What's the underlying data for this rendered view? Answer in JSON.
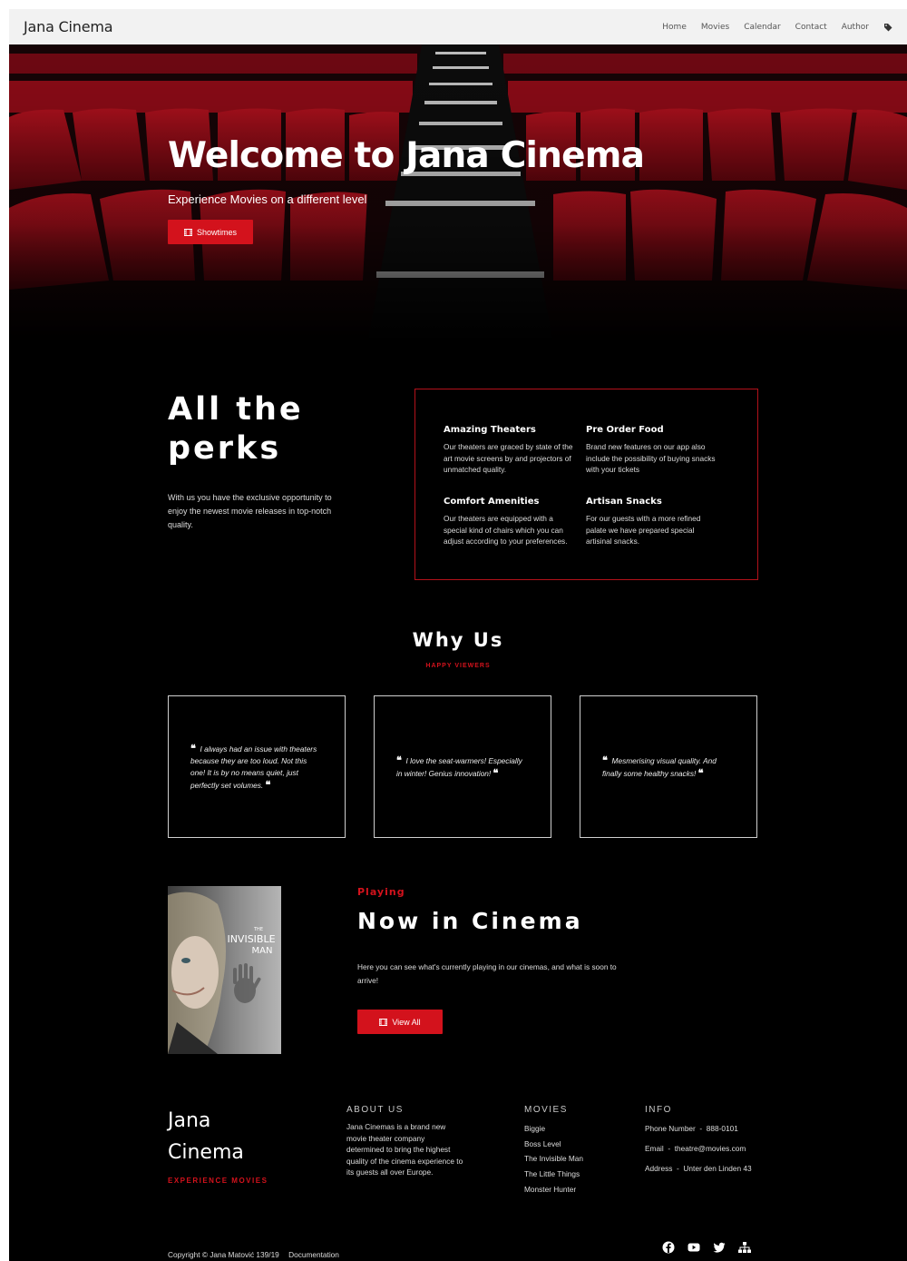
{
  "nav": {
    "brand": "Jana Cinema",
    "items": [
      "Home",
      "Movies",
      "Calendar",
      "Contact",
      "Author"
    ]
  },
  "hero": {
    "title": "Welcome to Jana Cinema",
    "subtitle": "Experience Movies on a different level",
    "button": "Showtimes"
  },
  "perks": {
    "title_line1": "All the",
    "title_line2": "perks",
    "description": "With us you have the exclusive opportunity to enjoy the newest movie releases in top-notch quality.",
    "items": [
      {
        "title": "Amazing Theaters",
        "text": "Our theaters are graced by state of the art movie screens by and projectors of unmatched quality."
      },
      {
        "title": "Pre Order Food",
        "text": "Brand new features on our app also include the possibility of buying snacks with your tickets"
      },
      {
        "title": "Comfort Amenities",
        "text": "Our theaters are equipped with a special kind of chairs which you can adjust according to your preferences."
      },
      {
        "title": "Artisan Snacks",
        "text": "For our guests with a more refined palate we have prepared special artisinal snacks."
      }
    ]
  },
  "why": {
    "title": "Why Us",
    "subtitle": "HAPPY VIEWERS",
    "quotes": [
      "I always had an issue with theaters because they are too loud. Not this one! It is by no means quiet, just perfectly set volumes.",
      "I love the seat-warmers! Especially in winter! Genius innovation!",
      "Mesmerising visual quality. And finally some healthy snacks!"
    ]
  },
  "now": {
    "label": "Playing",
    "title": "Now in Cinema",
    "description": "Here you can see what's currently playing in our cinemas, and what is soon to arrive!",
    "button": "View All",
    "poster": {
      "title_line1": "THE",
      "title_line2": "INVISIBLE",
      "title_line3": "MAN"
    }
  },
  "footer": {
    "brand_line1": "Jana",
    "brand_line2": "Cinema",
    "tagline": "EXPERIENCE MOVIES",
    "about_title": "ABOUT US",
    "about_text": "Jana Cinemas is a brand new movie theater company determined to bring the highest quality of the cinema experience to its guests all over Europe.",
    "movies_title": "MOVIES",
    "movies": [
      "Biggie",
      "Boss Level",
      "The Invisible Man",
      "The Little Things",
      "Monster Hunter"
    ],
    "info_title": "INFO",
    "info": [
      "Phone Number  -  888-0101",
      "Email  -  theatre@movies.com",
      "Address  -  Unter den Linden 43"
    ],
    "copyright": "Copyright © Jana Matović 139/19",
    "documentation": "Documentation"
  },
  "colors": {
    "accent": "#d3121c",
    "background": "#000000",
    "nav": "#f2f2f2"
  },
  "icons": {
    "nav": "tag-icon",
    "button": "film-icon",
    "socials": [
      "facebook-icon",
      "youtube-icon",
      "twitter-icon",
      "sitemap-icon"
    ]
  }
}
